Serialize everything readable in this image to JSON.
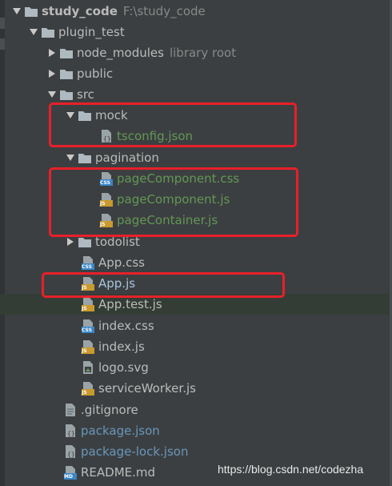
{
  "tree": {
    "root": {
      "label": "study_code",
      "path": "F:\\study_code"
    },
    "plugin_test": "plugin_test",
    "node_modules": {
      "label": "node_modules",
      "hint": "library root"
    },
    "public": "public",
    "src": "src",
    "mock": "mock",
    "tsconfig": "tsconfig.json",
    "pagination": "pagination",
    "page_component_css": "pageComponent.css",
    "page_component_js": "pageComponent.js",
    "page_container_js": "pageContainer.js",
    "todolist": "todolist",
    "app_css": "App.css",
    "app_js": "App.js",
    "app_test_js": "App.test.js",
    "index_css": "index.css",
    "index_js": "index.js",
    "logo_svg": "logo.svg",
    "service_worker_js": "serviceWorker.js",
    "gitignore": ".gitignore",
    "package_json": "package.json",
    "package_lock_json": "package-lock.json",
    "readme_md": "README.md"
  },
  "badges": {
    "css": "CSS",
    "js": "JS",
    "md": "MD"
  },
  "watermark": "https://blog.csdn.net/codezha",
  "colors": {
    "background": "#3c3f41",
    "text": "#bbbbbb",
    "modified_green": "#629755",
    "new_blue": "#6897bb",
    "highlight_box": "#e8202a",
    "folder": "#aeb9c0",
    "js_badge": "#c99a2e",
    "css_badge": "#3a86c7"
  }
}
